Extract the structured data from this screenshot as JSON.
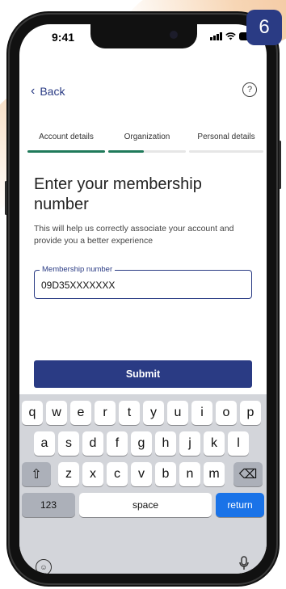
{
  "badge": {
    "step_number": "6"
  },
  "status_bar": {
    "time": "9:41"
  },
  "nav": {
    "back_label": "Back",
    "help_icon_glyph": "?"
  },
  "steps": [
    {
      "label": "Account details",
      "state": "complete",
      "color": "#1f7a5a"
    },
    {
      "label": "Organization",
      "state": "in-progress",
      "color": "#1f7a5a"
    },
    {
      "label": "Personal details",
      "state": "pending",
      "color": "#e6e6e6"
    }
  ],
  "page": {
    "title": "Enter your membership number",
    "subtitle": "This will help us correctly associate your account and provide you a better experience"
  },
  "membership_field": {
    "label": "Membership number",
    "value": "09D35XXXXXXX"
  },
  "submit_label": "Submit",
  "keyboard": {
    "row1": [
      "q",
      "w",
      "e",
      "r",
      "t",
      "y",
      "u",
      "i",
      "o",
      "p"
    ],
    "row2": [
      "a",
      "s",
      "d",
      "f",
      "g",
      "h",
      "j",
      "k",
      "l"
    ],
    "row3": [
      "z",
      "x",
      "c",
      "v",
      "b",
      "n",
      "m"
    ],
    "shift_glyph": "⇧",
    "delete_glyph": "⌫",
    "numbers_label": "123",
    "space_label": "space",
    "return_label": "return",
    "emoji_glyph": "☺",
    "mic_glyph": "🎙"
  },
  "colors": {
    "brand": "#2a3b84",
    "progress": "#1f7a5a",
    "return_key": "#1a73e8"
  }
}
